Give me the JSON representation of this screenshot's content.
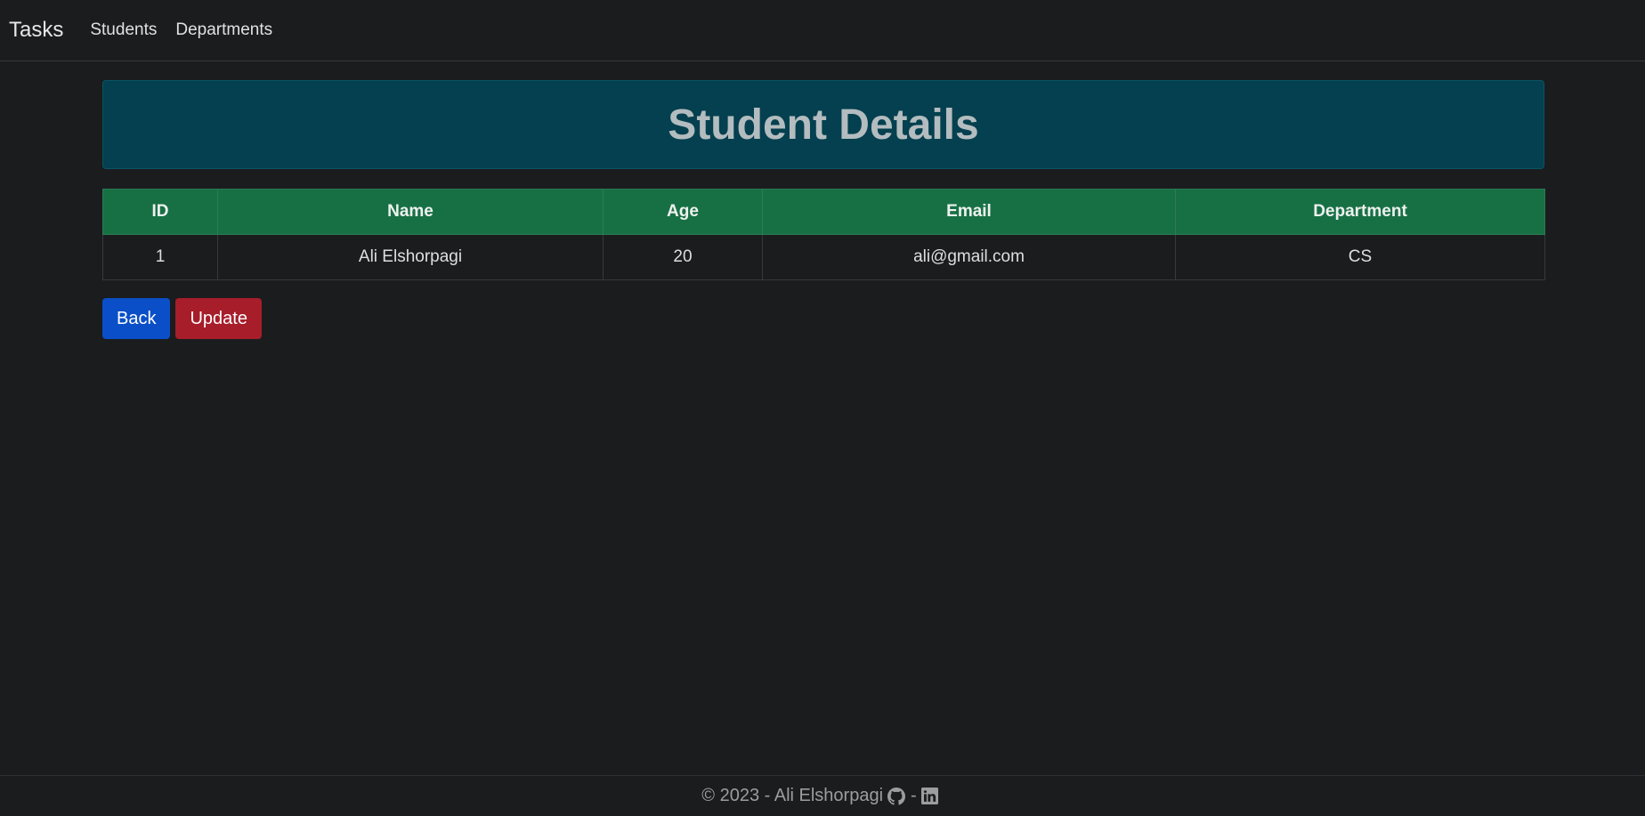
{
  "navbar": {
    "brand": "Tasks",
    "links": [
      "Students",
      "Departments"
    ]
  },
  "page": {
    "title": "Student Details"
  },
  "table": {
    "headers": [
      "ID",
      "Name",
      "Age",
      "Email",
      "Department"
    ],
    "rows": [
      [
        "1",
        "Ali Elshorpagi",
        "20",
        "ali@gmail.com",
        "CS"
      ]
    ]
  },
  "actions": {
    "back_label": "Back",
    "update_label": "Update",
    "back_color": "#0a4fc7",
    "update_color": "#a71d2a"
  },
  "footer": {
    "text": "© 2023 - Ali Elshorpagi",
    "separator": "-",
    "icons": [
      "github-icon",
      "linkedin-icon"
    ]
  },
  "colors": {
    "background": "#1b1c1e",
    "banner": "#04404f",
    "table_header": "#177044"
  }
}
